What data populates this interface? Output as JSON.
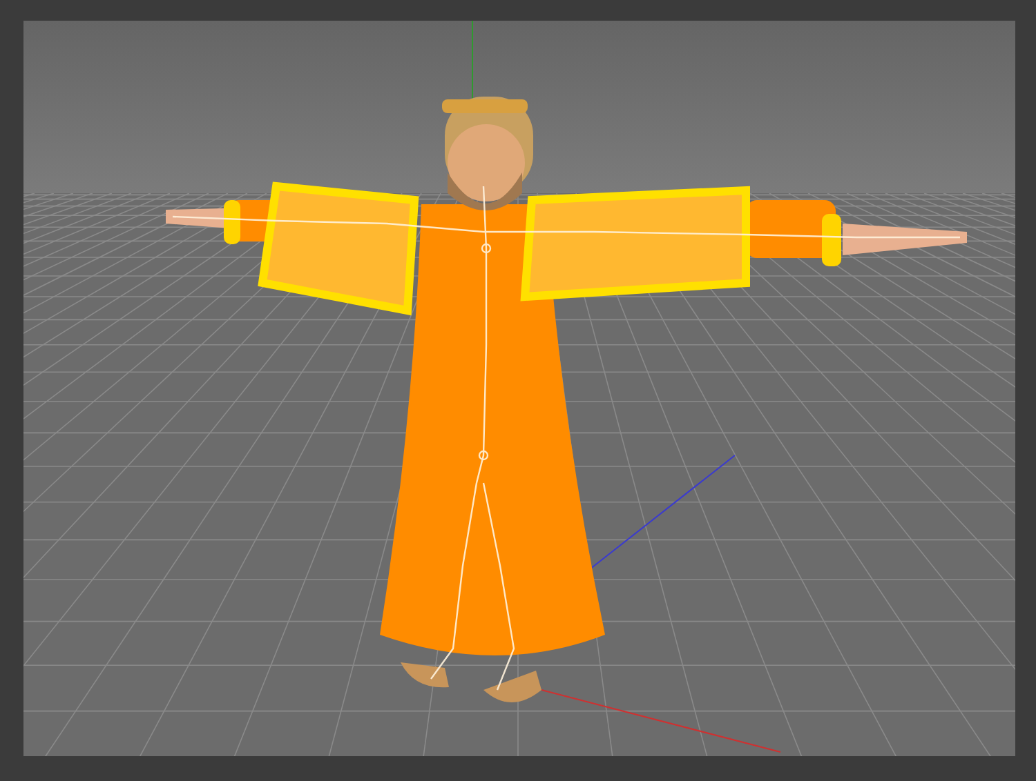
{
  "viewport": {
    "grid_visible": true,
    "axes_visible": true,
    "skeleton_visible": true
  }
}
